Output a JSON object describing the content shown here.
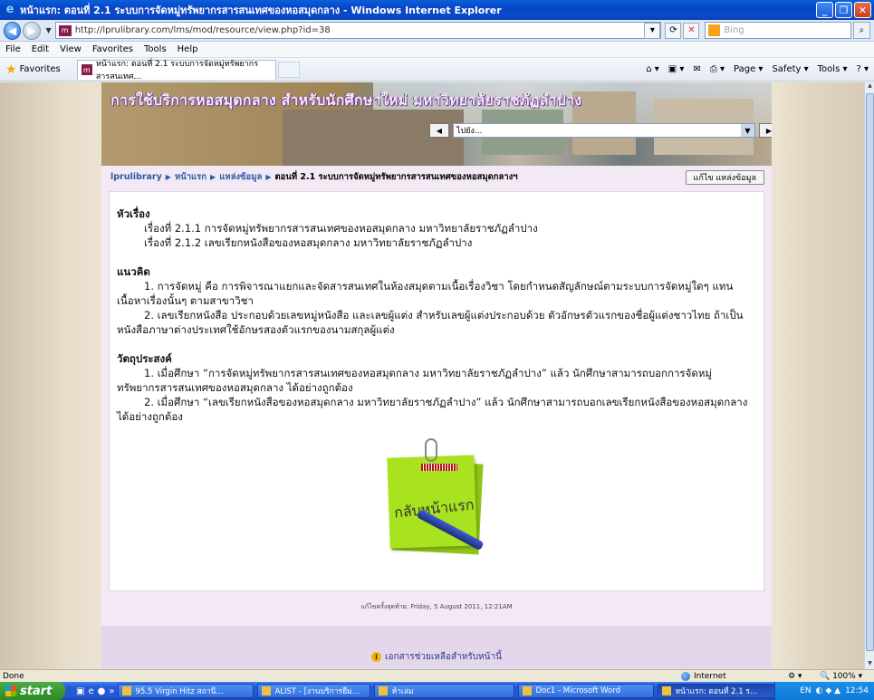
{
  "window": {
    "title": "หน้าแรก: ตอนที่ 2.1 ระบบการจัดหมู่ทรัพยากรสารสนเทศของหอสมุดกลาง - Windows Internet Explorer"
  },
  "address_bar": {
    "url": "http://lprulibrary.com/lms/mod/resource/view.php?id=38",
    "search_placeholder": "Bing"
  },
  "menu": [
    "File",
    "Edit",
    "View",
    "Favorites",
    "Tools",
    "Help"
  ],
  "favorites_bar": {
    "favorites_label": "Favorites",
    "tab_title": "หน้าแรก: ตอนที่ 2.1 ระบบการจัดหมู่ทรัพยากรสารสนเทศ...",
    "commands": [
      "Page ▾",
      "Safety ▾",
      "Tools ▾"
    ]
  },
  "banner": {
    "title": "การใช้บริการหอสมุดกลาง สำหรับนักศึกษาใหม่ มหาวิทยาลัยราชภัฏลำปาง",
    "jump_label": "ไปยัง..."
  },
  "breadcrumb": {
    "items": [
      "lprulibrary",
      "หน้าแรก",
      "แหล่งข้อมูล"
    ],
    "current": "ตอนที่ 2.1 ระบบการจัดหมู่ทรัพยากรสารสนเทศของหอสมุดกลางฯ",
    "edit_button": "แก้ไข แหล่งข้อมูล"
  },
  "content": {
    "topics_heading": "หัวเรื่อง",
    "topics": [
      "เรื่องที่ 2.1.1 การจัดหมู่ทรัพยากรสารสนเทศของหอสมุดกลาง มหาวิทยาลัยราชภัฏลำปาง",
      "เรื่องที่ 2.1.2 เลขเรียกหนังสือของหอสมุดกลาง มหาวิทยาลัยราชภัฏลำปาง"
    ],
    "concepts_heading": "แนวคิด",
    "concepts": [
      "1. การจัดหมู่ คือ การพิจารณาแยกและจัดสารสนเทศในห้องสมุดตามเนื้อเรื่องวิชา โดยกำหนดสัญลักษณ์ตามระบบการจัดหมู่ใดๆ แทนเนื้อหาเรื่องนั้นๆ ตามสาขาวิชา",
      "2. เลขเรียกหนังสือ ประกอบด้วยเลขหมู่หนังสือ และเลขผู้แต่ง สำหรับเลขผู้แต่งประกอบด้วย ตัวอักษรตัวแรกของชื่อผู้แต่งชาวไทย ถ้าเป็นหนังสือภาษาต่างประเทศใช้อักษรสองตัวแรกของนามสกุลผู้แต่ง"
    ],
    "objectives_heading": "วัตถุประสงค์",
    "objectives": [
      "1. เมื่อศึกษา “การจัดหมู่ทรัพยากรสารสนเทศของหอสมุดกลาง มหาวิทยาลัยราชภัฏลำปาง” แล้ว นักศึกษาสามารถบอกการจัดหมู่ทรัพยากรสารสนเทศของหอสมุดกลาง ได้อย่างถูกต้อง",
      "2. เมื่อศึกษา “เลขเรียกหนังสือของหอสมุดกลาง มหาวิทยาลัยราชภัฏลำปาง” แล้ว นักศึกษาสามารถบอกเลขเรียกหนังสือของหอสมุดกลาง ได้อย่างถูกต้อง"
    ],
    "back_home_note": "กลับหน้าแรก"
  },
  "footer": {
    "last_modified": "แก้ไขครั้งสุดท้าย: Friday, 5 August 2011, 12:21AM",
    "help_link": "เอกสารช่วยเหลือสำหรับหน้านี้"
  },
  "status_bar": {
    "status": "Done",
    "zone": "Internet",
    "zoom": "100%"
  },
  "taskbar": {
    "start_label": "start",
    "tasks": [
      "95.5 Virgin Hitz สถานี...",
      "ALIST - [งานบริการยืม...",
      "ห้าเล่ม",
      "Doc1 - Microsoft Word",
      "หน้าแรก: ตอนที่ 2.1 ร..."
    ],
    "active_task_index": 4,
    "tray_lang": "EN",
    "clock": "12:54"
  }
}
